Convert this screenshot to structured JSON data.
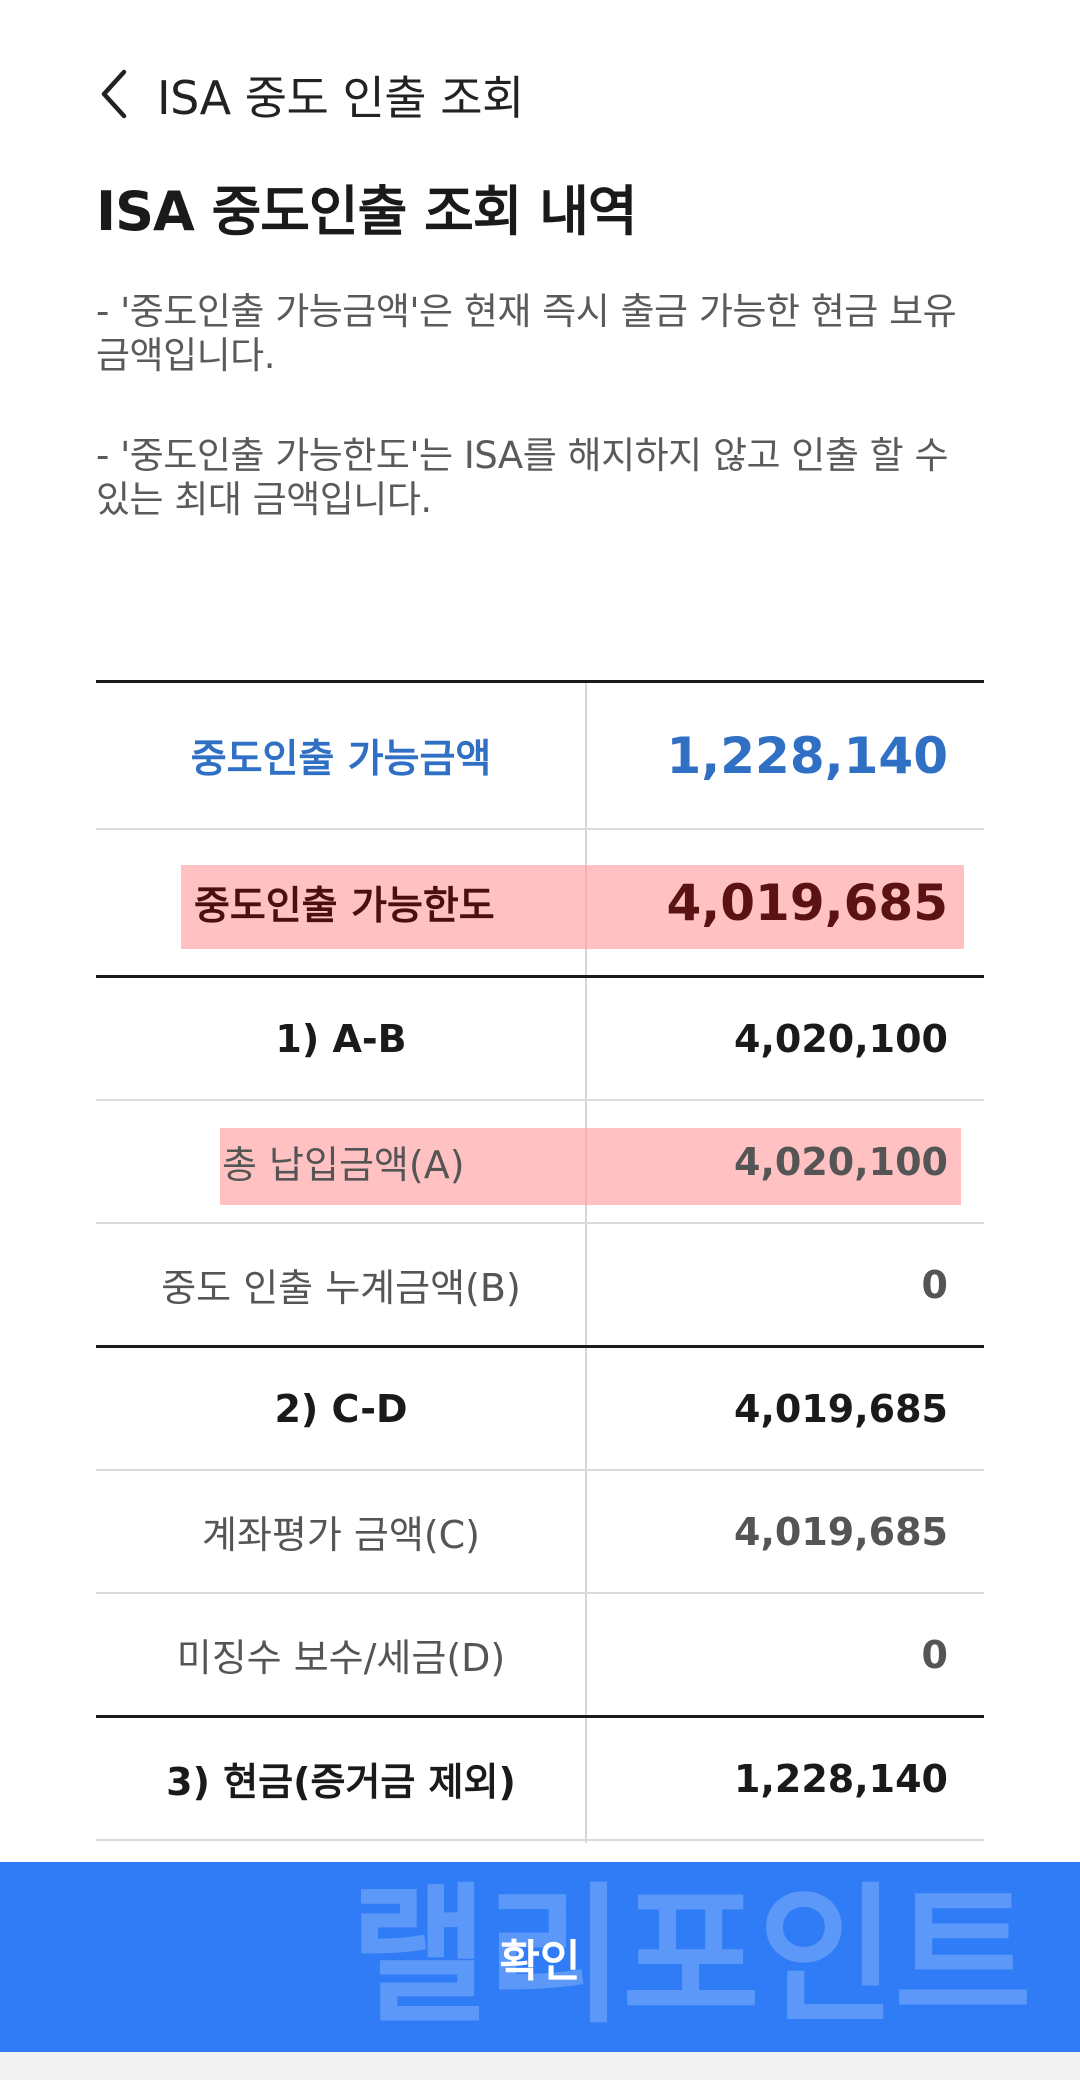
{
  "header": {
    "title": "ISA 중도 인출 조회",
    "back_icon": "chevron-left-icon"
  },
  "page_title": "ISA 중도인출 조회 내역",
  "descriptions": [
    "- '중도인출 가능금액'은 현재 즉시 출금 가능한 현금 보유 금액입니다.",
    "- '중도인출 가능한도'는 ISA를 해지하지 않고 인출 할 수 있는 최대 금액입니다."
  ],
  "table": {
    "available_amount": {
      "label": "중도인출 가능금액",
      "value": "1,228,140"
    },
    "available_limit": {
      "label": "중도인출 가능한도",
      "value": "4,019,685"
    },
    "a_minus_b": {
      "label": "1) A-B",
      "value": "4,020,100"
    },
    "total_deposit": {
      "label": "총 납입금액(A)",
      "value": "4,020,100"
    },
    "cumulative_withdrawal": {
      "label": "중도 인출 누계금액(B)",
      "value": "0"
    },
    "c_minus_d": {
      "label": "2) C-D",
      "value": "4,019,685"
    },
    "account_valuation": {
      "label": "계좌평가 금액(C)",
      "value": "4,019,685"
    },
    "uncollected_fees": {
      "label": "미징수 보수/세금(D)",
      "value": "0"
    },
    "cash": {
      "label": "3) 현금(증거금 제외)",
      "value": "1,228,140"
    }
  },
  "confirm_button": {
    "label": "확인"
  },
  "watermark": "랠리포인트",
  "colors": {
    "accent_blue": "#2f6fc4",
    "button_blue": "#2f7cf6",
    "highlight": "#ffa0a0",
    "limit_text": "#5a1212"
  }
}
